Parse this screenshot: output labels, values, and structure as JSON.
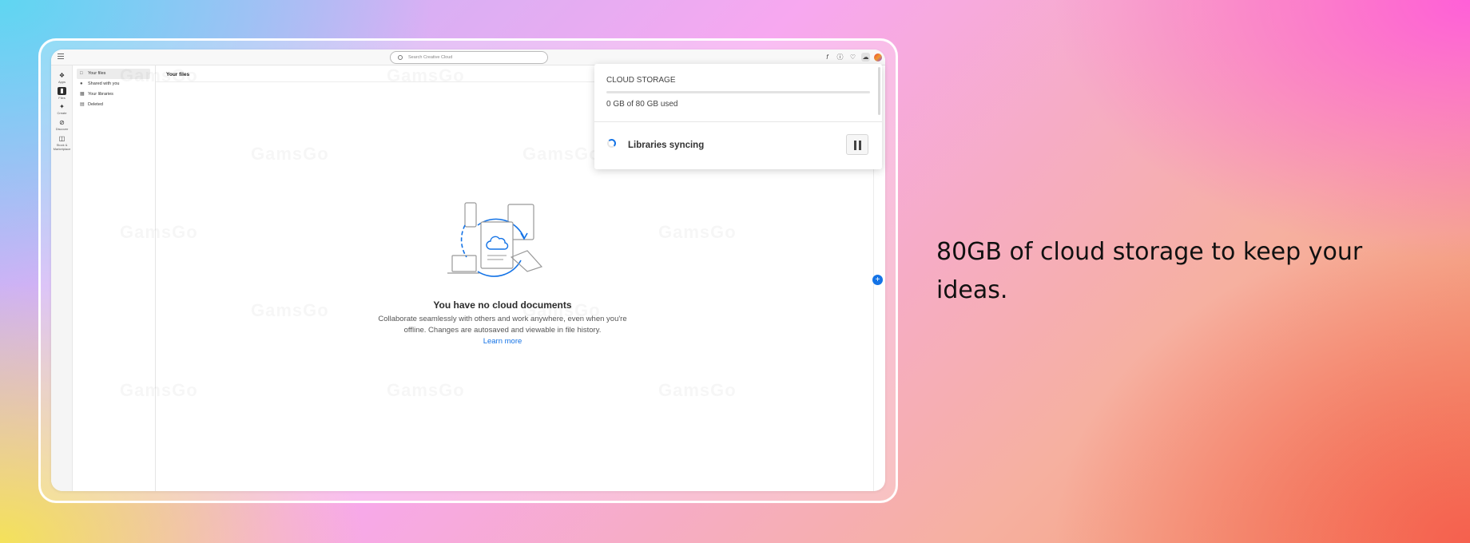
{
  "tagline": "80GB of cloud storage to keep your ideas.",
  "watermark": "GamsGo",
  "topbar": {
    "search_placeholder": "Search Creative Cloud",
    "icons": [
      "font-icon",
      "help-icon",
      "bell-icon",
      "cloud-icon",
      "avatar"
    ]
  },
  "rail": {
    "items": [
      {
        "label": "Apps",
        "icon": "apps-icon"
      },
      {
        "label": "Files",
        "icon": "folder-icon",
        "active": true
      },
      {
        "label": "Create",
        "icon": "create-icon"
      },
      {
        "label": "Discover",
        "icon": "discover-icon"
      },
      {
        "label": "Stock & Marketplace",
        "icon": "basket-icon"
      }
    ]
  },
  "sidenav": {
    "items": [
      {
        "label": "Your files",
        "icon": "file-icon",
        "active": true
      },
      {
        "label": "Shared with you",
        "icon": "people-icon"
      },
      {
        "label": "Your libraries",
        "icon": "library-icon"
      },
      {
        "label": "Deleted",
        "icon": "trash-icon"
      }
    ]
  },
  "main": {
    "title": "Your files",
    "empty_title": "You have no cloud documents",
    "empty_desc_line1": "Collaborate seamlessly with others and work anywhere, even when you're",
    "empty_desc_line2": "offline. Changes are autosaved and viewable in file history.",
    "learn_more": "Learn more"
  },
  "popover": {
    "section_title": "CLOUD STORAGE",
    "usage_fraction": 0,
    "used_text": "0 GB of 80 GB used",
    "sync_text": "Libraries syncing"
  },
  "colors": {
    "accent": "#1473e6"
  }
}
